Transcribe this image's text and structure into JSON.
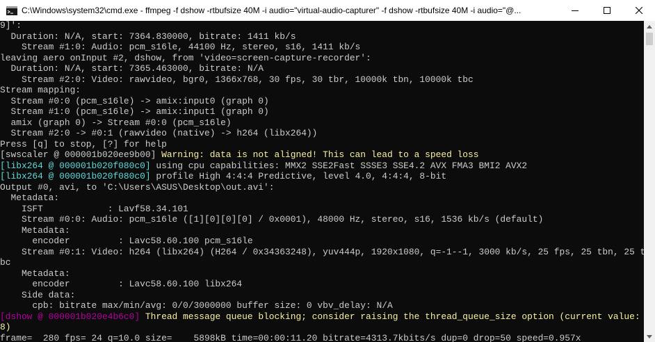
{
  "window": {
    "title": "C:\\Windows\\system32\\cmd.exe - ffmpeg  -f dshow -rtbufsize 40M -i audio=\"virtual-audio-capturer\" -f dshow -rtbufsize 40M -i audio=\"@...",
    "icon": "cmd-icon",
    "controls": [
      "minimize-icon",
      "maximize-icon",
      "close-icon"
    ]
  },
  "colors": {
    "background": "#0c0c0c",
    "text": "#cccccc",
    "warning": "#f9f1a5",
    "libx264_tag": "#61d6d6",
    "dshow_tag": "#b4009e"
  },
  "console": {
    "lines": [
      {
        "segments": [
          {
            "text": "9]':",
            "tone": "default"
          }
        ]
      },
      {
        "segments": [
          {
            "text": "  Duration: N/A, start: 7364.830000, bitrate: 1411 kb/s",
            "tone": "default"
          }
        ]
      },
      {
        "segments": [
          {
            "text": "    Stream #1:0: Audio: pcm_s16le, 44100 Hz, stereo, s16, 1411 kb/s",
            "tone": "default"
          }
        ]
      },
      {
        "segments": [
          {
            "text": "leaving aero onInput #2, dshow, from 'video=screen-capture-recorder':",
            "tone": "default"
          }
        ]
      },
      {
        "segments": [
          {
            "text": "  Duration: N/A, start: 7365.463000, bitrate: N/A",
            "tone": "default"
          }
        ]
      },
      {
        "segments": [
          {
            "text": "    Stream #2:0: Video: rawvideo, bgr0, 1366x768, 30 fps, 30 tbr, 10000k tbn, 10000k tbc",
            "tone": "default"
          }
        ]
      },
      {
        "segments": [
          {
            "text": "Stream mapping:",
            "tone": "default"
          }
        ]
      },
      {
        "segments": [
          {
            "text": "  Stream #0:0 (pcm_s16le) -> amix:input0 (graph 0)",
            "tone": "default"
          }
        ]
      },
      {
        "segments": [
          {
            "text": "  Stream #1:0 (pcm_s16le) -> amix:input1 (graph 0)",
            "tone": "default"
          }
        ]
      },
      {
        "segments": [
          {
            "text": "  amix (graph 0) -> Stream #0:0 (pcm_s16le)",
            "tone": "default"
          }
        ]
      },
      {
        "segments": [
          {
            "text": "  Stream #2:0 -> #0:1 (rawvideo (native) -> h264 (libx264))",
            "tone": "default"
          }
        ]
      },
      {
        "segments": [
          {
            "text": "Press [q] to stop, [?] for help",
            "tone": "default"
          }
        ]
      },
      {
        "segments": [
          {
            "text": "[swscaler @ 000001b020ee9b00] ",
            "tone": "default"
          },
          {
            "text": "Warning: data is not aligned! This can lead to a speed loss",
            "tone": "warning"
          }
        ]
      },
      {
        "segments": [
          {
            "text": "[libx264 @ 000001b020f080c0] ",
            "tone": "libx264"
          },
          {
            "text": "using cpu capabilities: MMX2 SSE2Fast SSSE3 SSE4.2 AVX FMA3 BMI2 AVX2",
            "tone": "default"
          }
        ]
      },
      {
        "segments": [
          {
            "text": "[libx264 @ 000001b020f080c0] ",
            "tone": "libx264"
          },
          {
            "text": "profile High 4:4:4 Predictive, level 4.0, 4:4:4, 8-bit",
            "tone": "default"
          }
        ]
      },
      {
        "segments": [
          {
            "text": "Output #0, avi, to 'C:\\Users\\ASUS\\Desktop\\out.avi':",
            "tone": "default"
          }
        ]
      },
      {
        "segments": [
          {
            "text": "  Metadata:",
            "tone": "default"
          }
        ]
      },
      {
        "segments": [
          {
            "text": "    ISFT            : Lavf58.34.101",
            "tone": "default"
          }
        ]
      },
      {
        "segments": [
          {
            "text": "    Stream #0:0: Audio: pcm_s16le ([1][0][0][0] / 0x0001), 48000 Hz, stereo, s16, 1536 kb/s (default)",
            "tone": "default"
          }
        ]
      },
      {
        "segments": [
          {
            "text": "    Metadata:",
            "tone": "default"
          }
        ]
      },
      {
        "segments": [
          {
            "text": "      encoder         : Lavc58.60.100 pcm_s16le",
            "tone": "default"
          }
        ]
      },
      {
        "segments": [
          {
            "text": "    Stream #0:1: Video: h264 (libx264) (H264 / 0x34363248), yuv444p, 1920x1080, q=-1--1, 3000 kb/s, 25 fps, 25 tbn, 25 t",
            "tone": "default"
          }
        ]
      },
      {
        "segments": [
          {
            "text": "bc",
            "tone": "default"
          }
        ]
      },
      {
        "segments": [
          {
            "text": "    Metadata:",
            "tone": "default"
          }
        ]
      },
      {
        "segments": [
          {
            "text": "      encoder         : Lavc58.60.100 libx264",
            "tone": "default"
          }
        ]
      },
      {
        "segments": [
          {
            "text": "    Side data:",
            "tone": "default"
          }
        ]
      },
      {
        "segments": [
          {
            "text": "      cpb: bitrate max/min/avg: 0/0/3000000 buffer size: 0 vbv_delay: N/A",
            "tone": "default"
          }
        ]
      },
      {
        "segments": [
          {
            "text": "[dshow @ 000001b020e4b6c0] ",
            "tone": "dshow"
          },
          {
            "text": "Thread message queue blocking; consider raising the thread_queue_size option (current value:",
            "tone": "warning"
          }
        ]
      },
      {
        "segments": [
          {
            "text": "8)",
            "tone": "warning"
          }
        ]
      },
      {
        "segments": [
          {
            "text": "frame=  280 fps= 24 q=10.0 size=    5898kB time=00:00:11.20 bitrate=4313.7kbits/s dup=0 drop=50 speed=0.957x",
            "tone": "default"
          }
        ]
      }
    ]
  },
  "scrollbar": {
    "up_icon": "scroll-up-arrow-icon",
    "down_icon": "scroll-down-arrow-icon"
  }
}
